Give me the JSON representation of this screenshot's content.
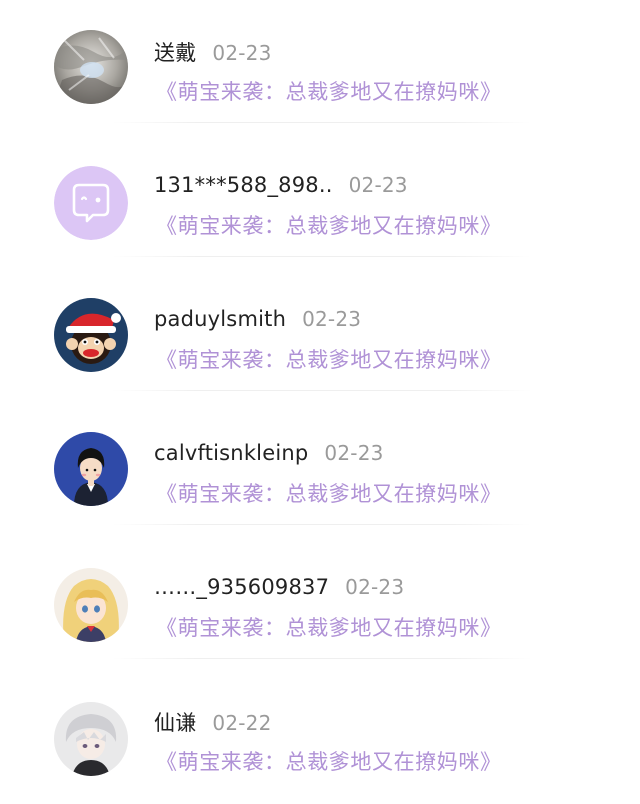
{
  "comments": [
    {
      "user": "送戴",
      "date": "02-23",
      "book": "《萌宝来袭：总裁爹地又在撩妈咪》",
      "avatar_icon": "photo-avatar-icon"
    },
    {
      "user": "131***588_898..",
      "date": "02-23",
      "book": "《萌宝来袭：总裁爹地又在撩妈咪》",
      "avatar_icon": "default-chat-avatar-icon"
    },
    {
      "user": "paduylsmith",
      "date": "02-23",
      "book": "《萌宝来袭：总裁爹地又在撩妈咪》",
      "avatar_icon": "monkey-santa-avatar-icon"
    },
    {
      "user": "calvftisnkleinp",
      "date": "02-23",
      "book": "《萌宝来袭：总裁爹地又在撩妈咪》",
      "avatar_icon": "cartoon-girl-avatar-icon"
    },
    {
      "user": "……_935609837",
      "date": "02-23",
      "book": "《萌宝来袭：总裁爹地又在撩妈咪》",
      "avatar_icon": "anime-girl-avatar-icon"
    },
    {
      "user": "仙谦",
      "date": "02-22",
      "book": "《萌宝来袭：总裁爹地又在撩妈咪》",
      "avatar_icon": "anime-boy-avatar-icon"
    }
  ],
  "colors": {
    "username": "#222222",
    "date": "#9a9a9a",
    "book_link": "#b092d6",
    "default_avatar": "#dcc6f5"
  }
}
